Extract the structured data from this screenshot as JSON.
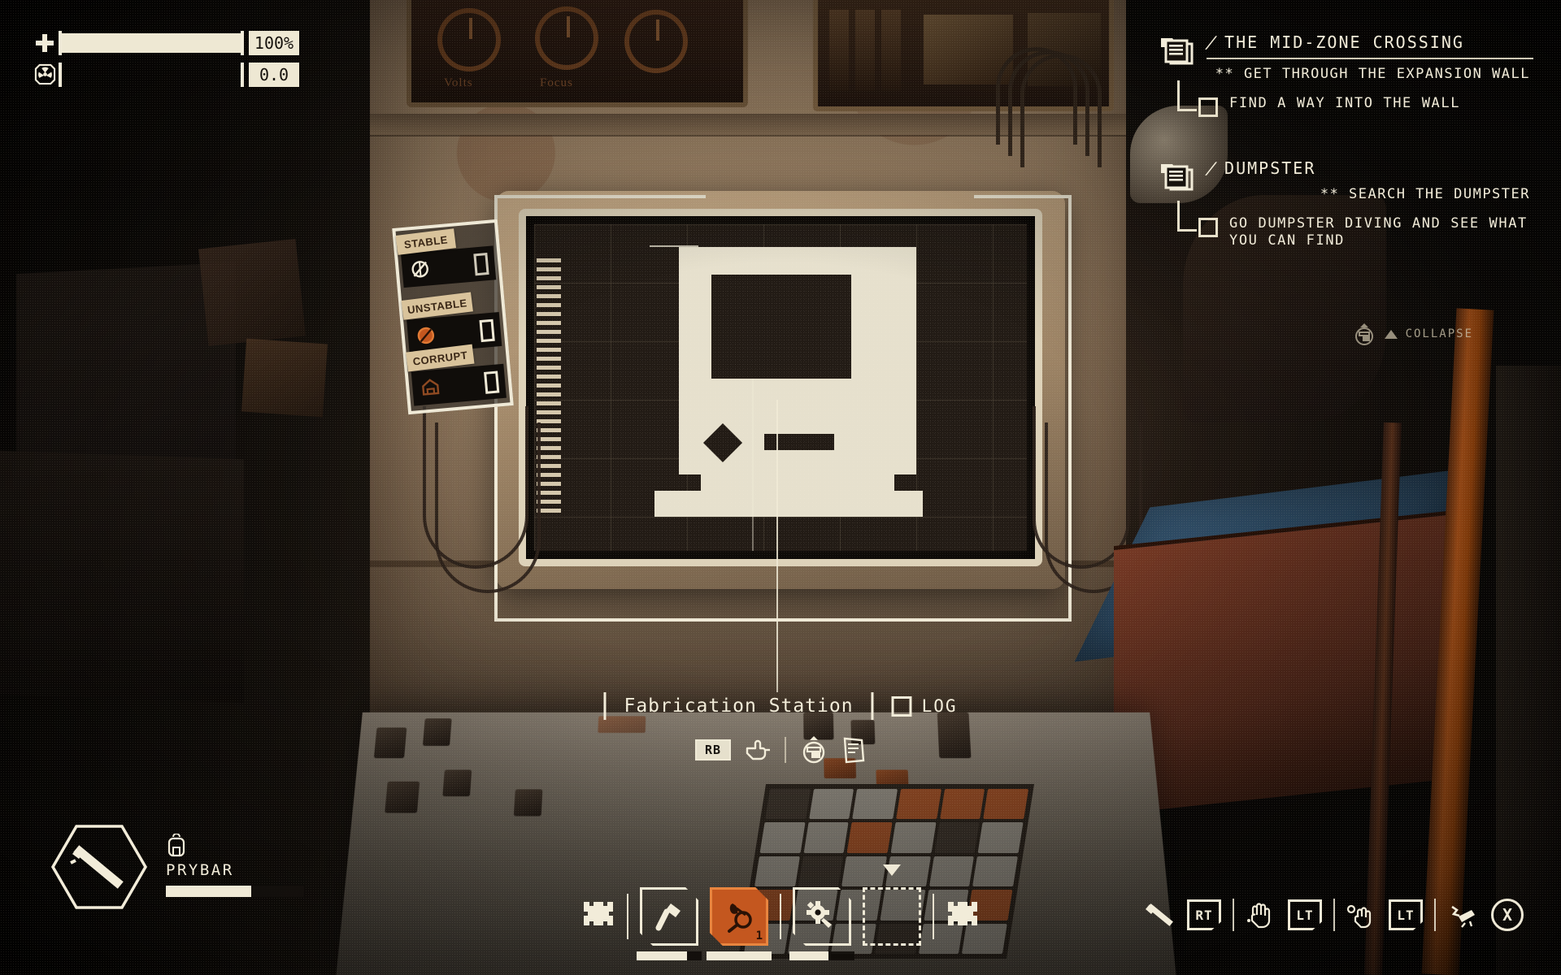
{
  "vitals": {
    "health": {
      "icon": "health-cross-icon",
      "value_label": "100%",
      "fill_pct": 100
    },
    "radiation": {
      "icon": "radiation-icon",
      "value_label": "0.0",
      "fill_pct": 0
    }
  },
  "quest_log": {
    "collapse": {
      "label": "COLLAPSE",
      "icon": "collapse-triangle-icon",
      "hint_icon": "log-toggle-icon"
    },
    "quests": [
      {
        "folder_icon": "quest-folder-icon",
        "slash": "/",
        "title": "THE MID-ZONE CROSSING",
        "objective": "** GET THROUGH THE EXPANSION WALL",
        "subtask": "FIND A WAY INTO THE WALL",
        "subtask_checked": false
      },
      {
        "folder_icon": "quest-folder-icon",
        "slash": "/",
        "title": "DUMPSTER",
        "objective": "** SEARCH THE DUMPSTER",
        "subtask": "GO DUMPSTER DIVING AND SEE WHAT YOU CAN FIND",
        "subtask_checked": false
      }
    ]
  },
  "sample_panel": {
    "rows": [
      {
        "label": "STABLE",
        "icon": "stable-sample-icon",
        "chip_filled": false
      },
      {
        "label": "UNSTABLE",
        "icon": "unstable-sample-icon",
        "chip_filled": false
      },
      {
        "label": "CORRUPT",
        "icon": "corrupt-sample-icon",
        "chip_filled": false
      }
    ]
  },
  "machine_labels": {
    "dial_left": "Volts",
    "dial_right": "Focus"
  },
  "interaction_bar": {
    "station_name": "Fabrication Station",
    "log_label": "LOG",
    "log_checkbox_checked": false,
    "prompts": [
      {
        "button": "RB",
        "icon": "pointing-hand-icon"
      },
      {
        "button": "",
        "icon": "screen-toggle-icon"
      },
      {
        "button": "",
        "icon": "notepad-icon"
      }
    ]
  },
  "equipment": {
    "slot_icon": "prybar-icon",
    "backpack_icon": "backpack-icon",
    "name": "PRYBAR",
    "durability_pct": 62
  },
  "hotbar": {
    "left_dpad_icon": "dpad-icon",
    "right_dpad_icon": "dpad-icon",
    "slots": [
      {
        "icon": "hammer-icon",
        "label": "",
        "count": "",
        "active": false,
        "empty": false,
        "bar_pct": 78
      },
      {
        "icon": "scanner-icon",
        "label": "",
        "count": "1",
        "active": true,
        "empty": false,
        "bar_pct": 100
      },
      {
        "icon": "gear-tool-icon",
        "label": "",
        "count": "",
        "active": false,
        "empty": false,
        "bar_pct": 60
      },
      {
        "icon": "empty-slot-icon",
        "label": "",
        "count": "",
        "active": false,
        "empty": true,
        "bar_pct": 0
      }
    ]
  },
  "action_prompts": [
    {
      "icon": "prybar-swing-icon",
      "button": "RT"
    },
    {
      "icon": "grab-hand-icon",
      "button": "LT"
    },
    {
      "icon": "throw-hand-icon",
      "button": "LT"
    },
    {
      "icon": "break-item-icon",
      "button": "X"
    }
  ],
  "colors": {
    "hud_ink": "#f2ecd9",
    "accent_orange": "#c4571f",
    "panel_dark": "#17120d",
    "tag_tan": "#d9c39b"
  }
}
